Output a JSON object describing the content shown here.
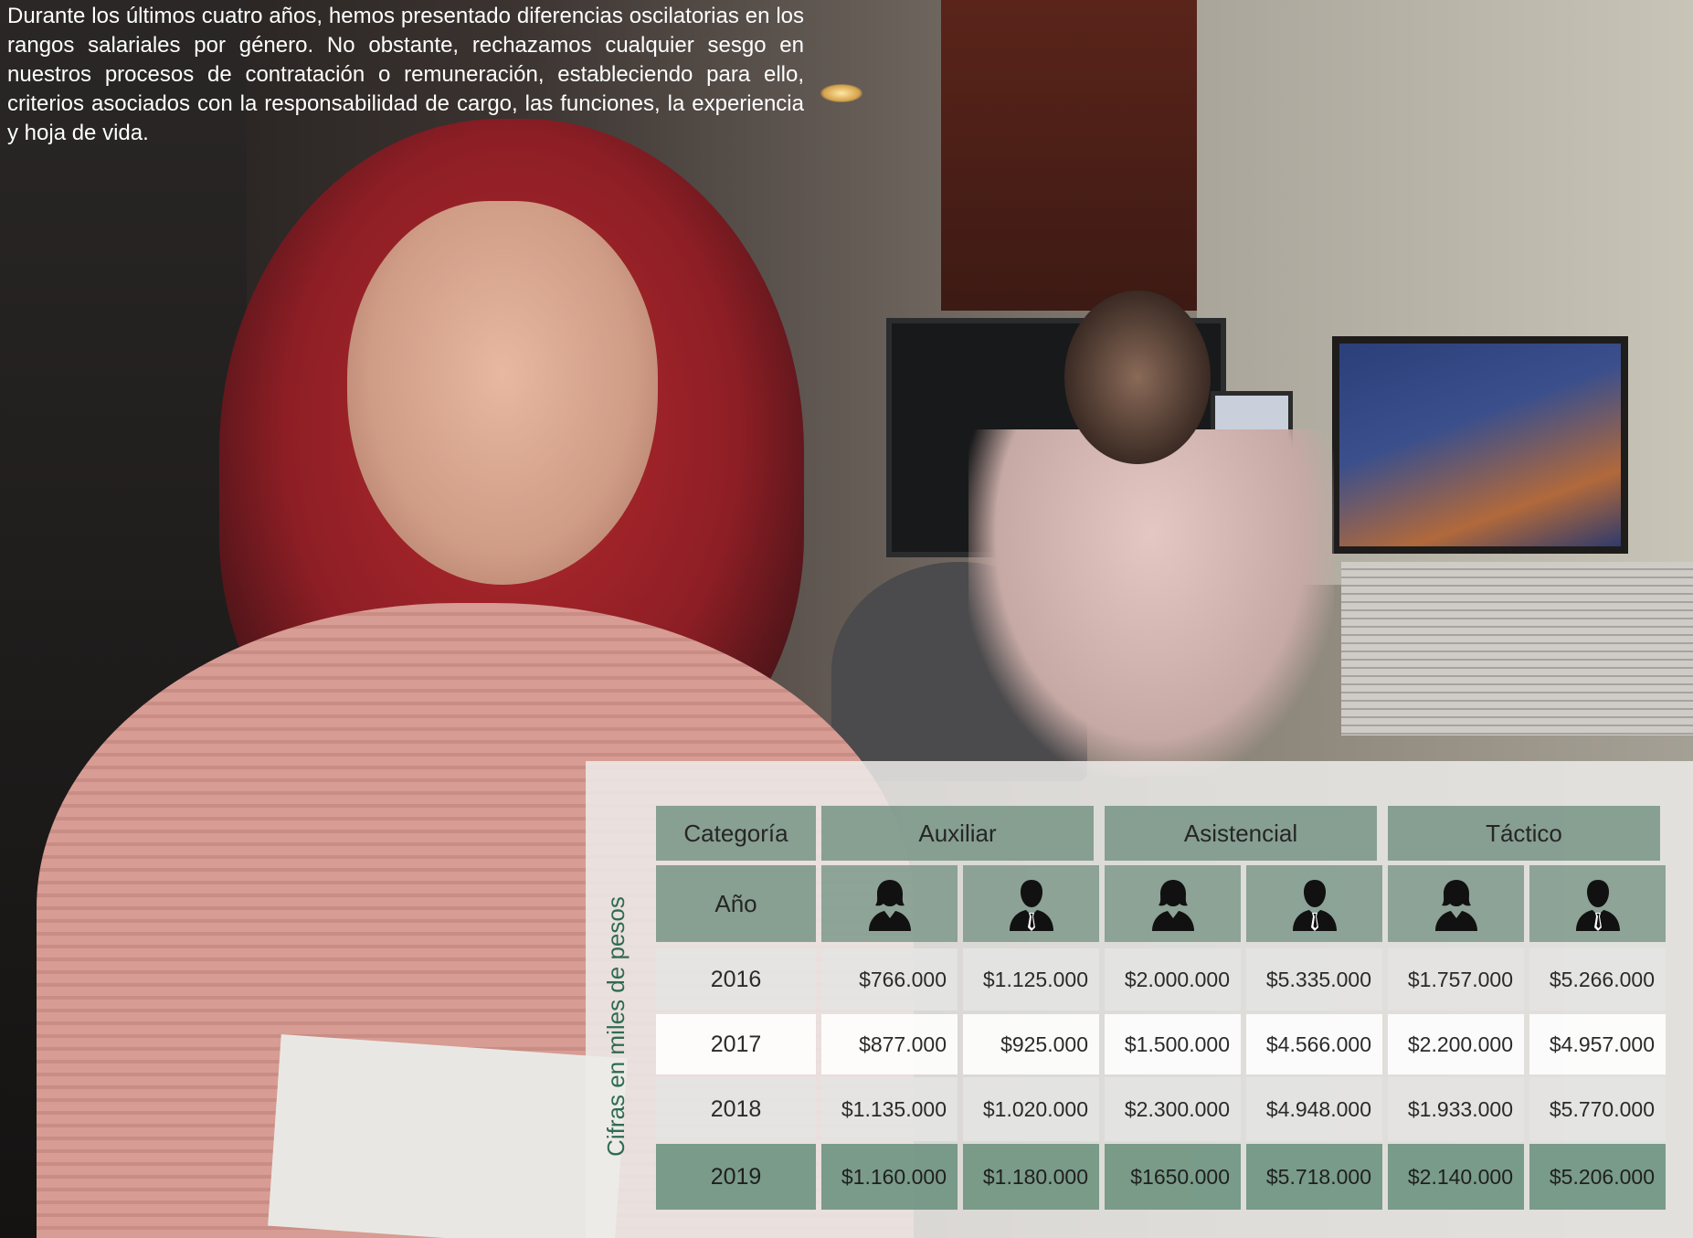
{
  "intro_text": "Durante los últimos cuatro años, hemos presentado diferencias oscilatorias en los rangos salariales por género. No obstante, rechazamos cualquier sesgo en nuestros procesos de contratación o remuneración, estableciendo para ello, criterios asociados con la responsabilidad de cargo, las funciones, la experiencia y hoja de vida.",
  "note": "Cifras en miles de pesos",
  "table": {
    "category_label": "Categoría",
    "year_label": "Año",
    "groups": [
      "Auxiliar",
      "Asistencial",
      "Táctico"
    ],
    "icons": [
      "woman-icon",
      "man-icon",
      "woman-icon",
      "man-icon",
      "woman-icon",
      "man-icon"
    ],
    "rows": [
      {
        "year": "2016",
        "values": [
          "$766.000",
          "$1.125.000",
          "$2.000.000",
          "$5.335.000",
          "$1.757.000",
          "$5.266.000"
        ]
      },
      {
        "year": "2017",
        "values": [
          "$877.000",
          "$925.000",
          "$1.500.000",
          "$4.566.000",
          "$2.200.000",
          "$4.957.000"
        ]
      },
      {
        "year": "2018",
        "values": [
          "$1.135.000",
          "$1.020.000",
          "$2.300.000",
          "$4.948.000",
          "$1.933.000",
          "$5.770.000"
        ]
      },
      {
        "year": "2019",
        "values": [
          "$1.160.000",
          "$1.180.000",
          "$1650.000",
          "$5.718.000",
          "$2.140.000",
          "$5.206.000"
        ]
      }
    ]
  },
  "colors": {
    "header_green": "#7a9688",
    "accent_green": "#2f6b52",
    "last_row_green": "#6e9480"
  }
}
